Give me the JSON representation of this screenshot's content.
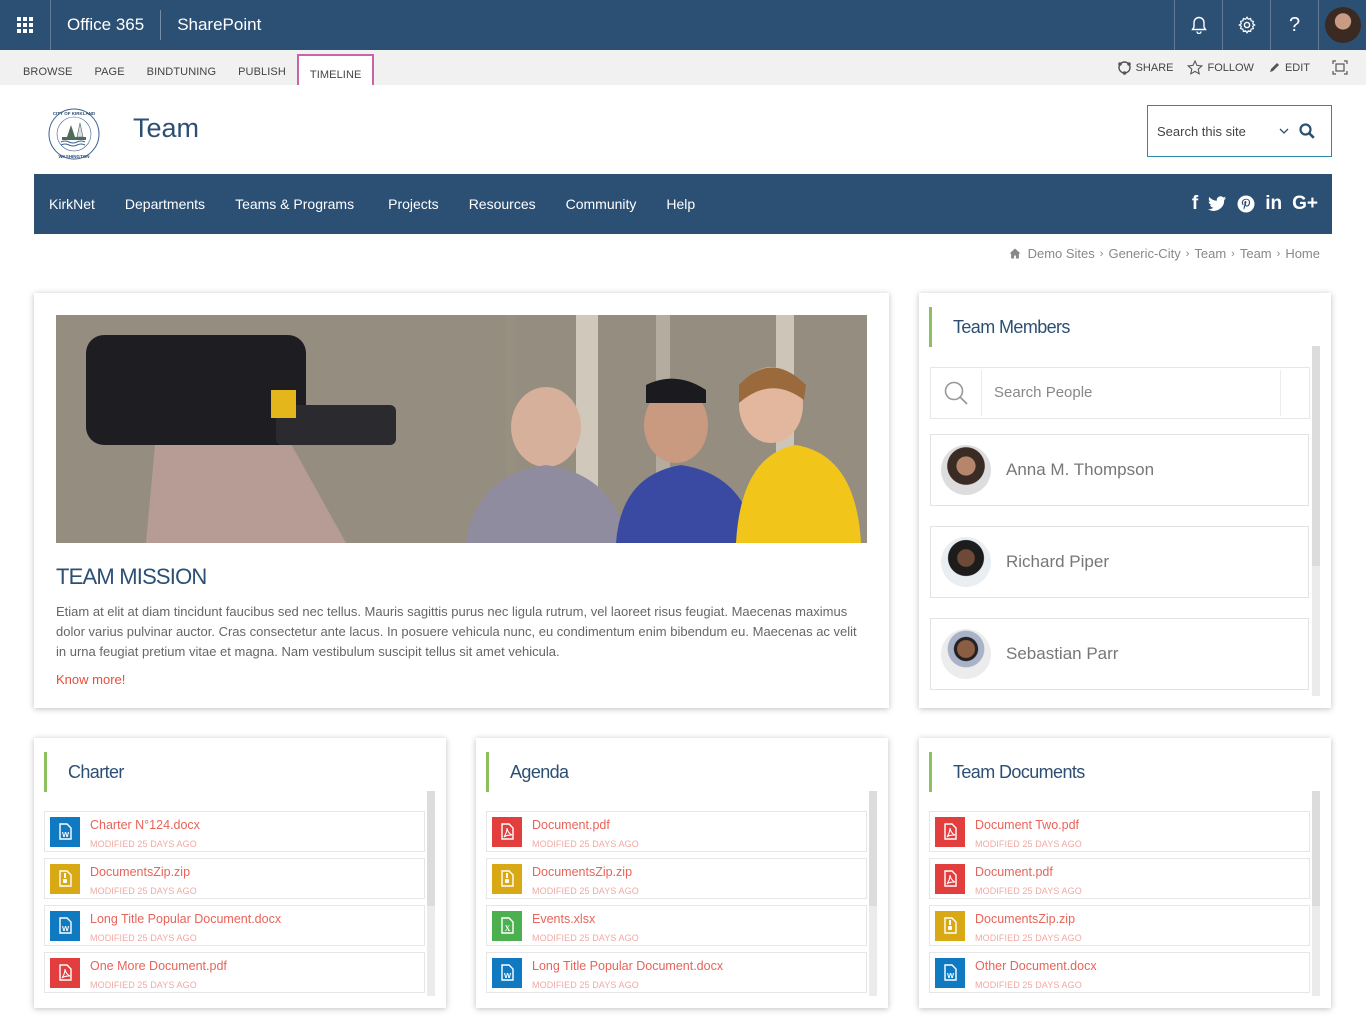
{
  "suitebar": {
    "app_launcher_icon": "waffle-icon",
    "office_label": "Office 365",
    "product_label": "SharePoint",
    "buttons": [
      {
        "name": "notifications",
        "icon": "bell-icon"
      },
      {
        "name": "settings",
        "icon": "gear-icon"
      },
      {
        "name": "help",
        "icon": "help-icon",
        "glyph": "?"
      }
    ],
    "avatar_icon": "user-avatar"
  },
  "ribbon": {
    "tabs": [
      "BROWSE",
      "PAGE",
      "BINDTUNING",
      "PUBLISH",
      "TIMELINE"
    ],
    "active_tab": "TIMELINE",
    "actions": [
      {
        "label": "SHARE",
        "icon": "share-icon"
      },
      {
        "label": "FOLLOW",
        "icon": "star-icon"
      },
      {
        "label": "EDIT",
        "icon": "pencil-icon"
      }
    ],
    "focus_icon": "fullscreen-icon"
  },
  "header": {
    "logo_text_top": "CITY OF KIRKLAND",
    "logo_text_bottom": "WASHINGTON",
    "site_title": "Team",
    "search_placeholder": "Search this site"
  },
  "nav": {
    "items": [
      "KirkNet",
      "Departments",
      "Teams & Programs",
      "Projects",
      "Resources",
      "Community",
      "Help"
    ],
    "social": [
      {
        "name": "facebook",
        "glyph": "f"
      },
      {
        "name": "twitter",
        "glyph": "twitter"
      },
      {
        "name": "pinterest",
        "glyph": "p"
      },
      {
        "name": "linkedin",
        "glyph": "in"
      },
      {
        "name": "google-plus",
        "glyph": "G+"
      }
    ]
  },
  "breadcrumb": {
    "home_icon": "home-icon",
    "items": [
      "Demo Sites",
      "Generic-City",
      "Team",
      "Team",
      "Home"
    ]
  },
  "mission": {
    "title": "TEAM MISSION",
    "text": "Etiam at elit at diam tincidunt faucibus sed nec tellus. Mauris sagittis purus nec ligula rutrum, vel laoreet risus feugiat. Maecenas maximus dolor varius pulvinar auctor. Cras consectetur ante lacus. In posuere vehicula nunc, eu condimentum enim bibendum eu. Maecenas ac velit in urna feugiat pretium vitae et magna. Nam vestibulum suscipit tellus sit amet vehicula.",
    "link": "Know more!"
  },
  "members": {
    "title": "Team Members",
    "search_placeholder": "Search People",
    "people": [
      {
        "name": "Anna M. Thompson"
      },
      {
        "name": "Richard Piper"
      },
      {
        "name": "Sebastian Parr"
      }
    ]
  },
  "doc_panels": [
    {
      "title": "Charter",
      "items": [
        {
          "name": "Charter N°124.docx",
          "type": "word",
          "meta": "MODIFIED 25 DAYS AGO"
        },
        {
          "name": "DocumentsZip.zip",
          "type": "zip",
          "meta": "MODIFIED 25 DAYS AGO"
        },
        {
          "name": "Long Title Popular Document.docx",
          "type": "word",
          "meta": "MODIFIED 25 DAYS AGO"
        },
        {
          "name": "One More Document.pdf",
          "type": "pdf",
          "meta": "MODIFIED 25 DAYS AGO"
        }
      ]
    },
    {
      "title": "Agenda",
      "items": [
        {
          "name": "Document.pdf",
          "type": "pdf",
          "meta": "MODIFIED 25 DAYS AGO"
        },
        {
          "name": "DocumentsZip.zip",
          "type": "zip",
          "meta": "MODIFIED 25 DAYS AGO"
        },
        {
          "name": "Events.xlsx",
          "type": "excel",
          "meta": "MODIFIED 25 DAYS AGO"
        },
        {
          "name": "Long Title Popular Document.docx",
          "type": "word",
          "meta": "MODIFIED 25 DAYS AGO"
        }
      ]
    },
    {
      "title": "Team Documents",
      "items": [
        {
          "name": "Document Two.pdf",
          "type": "pdf",
          "meta": "MODIFIED 25 DAYS AGO"
        },
        {
          "name": "Document.pdf",
          "type": "pdf",
          "meta": "MODIFIED 25 DAYS AGO"
        },
        {
          "name": "DocumentsZip.zip",
          "type": "zip",
          "meta": "MODIFIED 25 DAYS AGO"
        },
        {
          "name": "Other Document.docx",
          "type": "word",
          "meta": "MODIFIED 25 DAYS AGO"
        }
      ]
    }
  ],
  "colors": {
    "brand": "#2c4f74",
    "accent_green": "#8cbf5e",
    "link_red": "#e74c3c",
    "ribbon_active": "#c964a6",
    "word": "#0f7ac1",
    "pdf": "#e23e3e",
    "zip": "#d8a914",
    "excel": "#4caf50"
  }
}
